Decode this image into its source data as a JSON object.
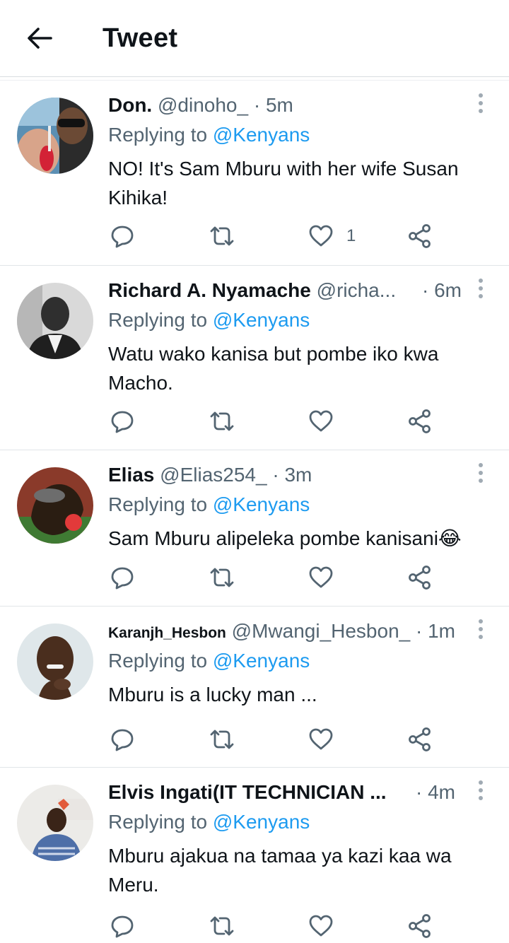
{
  "header": {
    "title": "Tweet"
  },
  "tweets": [
    {
      "name": "Don.",
      "handle": "@dinoho_",
      "time": "5m",
      "replying_prefix": "Replying to ",
      "replying_to": "@Kenyans",
      "text": "NO! It's Sam Mburu with her wife Susan Kihika!",
      "likes": "1"
    },
    {
      "name": "Richard A. Nyamache",
      "handle": "@richa...",
      "time": "6m",
      "replying_prefix": "Replying to ",
      "replying_to": "@Kenyans",
      "text": "Watu wako kanisa but pombe iko kwa Macho.",
      "likes": ""
    },
    {
      "name": "Elias",
      "handle": "@Elias254_",
      "time": "3m",
      "replying_prefix": "Replying to ",
      "replying_to": "@Kenyans",
      "text": "Sam Mburu alipeleka pombe kanisani😂",
      "likes": ""
    },
    {
      "name": "Karanjh_Hesbon",
      "handle": "@Mwangi_Hesbon_",
      "time": "1m",
      "replying_prefix": "Replying to ",
      "replying_to": "@Kenyans",
      "text": "Mburu is a lucky man ...",
      "likes": ""
    },
    {
      "name": "Elvis Ingati(IT TECHNICIAN ...",
      "handle": "",
      "time": "4m",
      "replying_prefix": "Replying to ",
      "replying_to": "@Kenyans",
      "text": "Mburu ajakua na tamaa ya kazi kaa wa Meru.",
      "likes": ""
    }
  ],
  "separator": "·",
  "icons": [
    "back-arrow-icon",
    "more-icon",
    "reply-icon",
    "retweet-icon",
    "like-icon",
    "share-icon"
  ],
  "colors": {
    "accent": "#1d9bf0",
    "secondary_text": "#536471",
    "primary_text": "#0f1419"
  }
}
